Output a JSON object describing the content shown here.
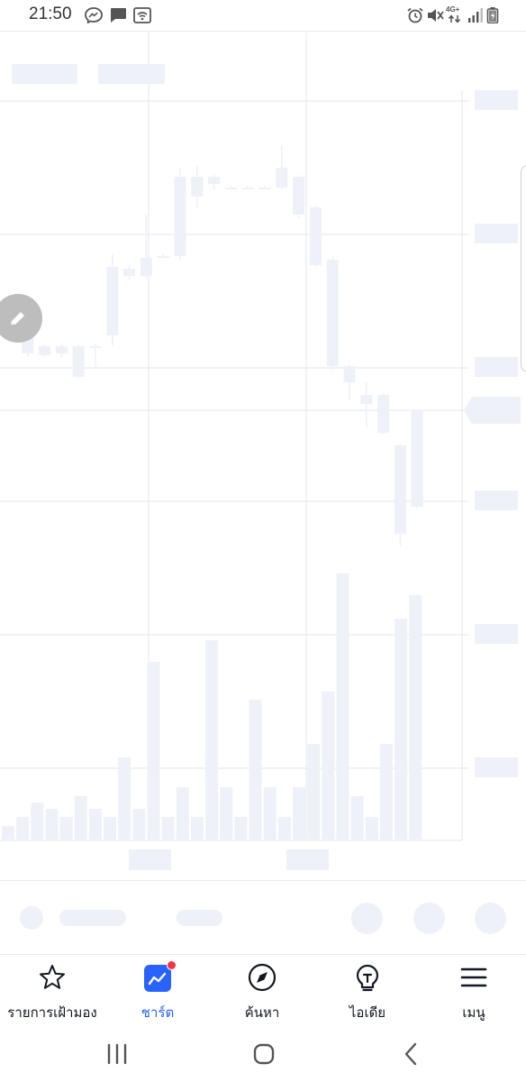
{
  "status_bar": {
    "time": "21:50",
    "left_icons": [
      "messenger-icon",
      "chat-icon",
      "wifi-call-icon"
    ],
    "right_icons": [
      "alarm-icon",
      "mute-icon",
      "network-4g-icon",
      "signal-icon",
      "battery-charging-icon"
    ],
    "network_label": "4G+"
  },
  "chart": {
    "type": "candlestick-with-volume",
    "loading_placeholder": true,
    "placeholder_color": "#eef1f8",
    "grid_color": "#e6ebf2",
    "candles": [
      {
        "o": 342,
        "c": 350,
        "h": 338,
        "l": 362
      },
      {
        "o": 374,
        "c": 392,
        "h": 372,
        "l": 395
      },
      {
        "o": 384,
        "c": 394,
        "h": 382,
        "l": 396
      },
      {
        "o": 384,
        "c": 392,
        "h": 382,
        "l": 396
      },
      {
        "o": 384,
        "c": 418,
        "h": 382,
        "l": 420
      },
      {
        "o": 384,
        "c": 386,
        "h": 382,
        "l": 408
      },
      {
        "o": 372,
        "c": 296,
        "h": 282,
        "l": 384
      },
      {
        "o": 306,
        "c": 298,
        "h": 294,
        "l": 310
      },
      {
        "o": 306,
        "c": 286,
        "h": 238,
        "l": 308
      },
      {
        "o": 286,
        "c": 284,
        "h": 282,
        "l": 286
      },
      {
        "o": 284,
        "c": 196,
        "h": 186,
        "l": 288
      },
      {
        "o": 218,
        "c": 196,
        "h": 184,
        "l": 230
      },
      {
        "o": 204,
        "c": 196,
        "h": 194,
        "l": 210
      },
      {
        "o": 208,
        "c": 208,
        "h": 206,
        "l": 210
      },
      {
        "o": 208,
        "c": 208,
        "h": 206,
        "l": 210
      },
      {
        "o": 208,
        "c": 208,
        "h": 206,
        "l": 210
      },
      {
        "o": 208,
        "c": 186,
        "h": 162,
        "l": 210
      },
      {
        "o": 196,
        "c": 238,
        "h": 194,
        "l": 242
      },
      {
        "o": 230,
        "c": 294,
        "h": 228,
        "l": 296
      },
      {
        "o": 288,
        "c": 406,
        "h": 284,
        "l": 410
      },
      {
        "o": 406,
        "c": 424,
        "h": 404,
        "l": 444
      },
      {
        "o": 438,
        "c": 448,
        "h": 424,
        "l": 474
      },
      {
        "o": 438,
        "c": 480,
        "h": 436,
        "l": 482
      },
      {
        "o": 494,
        "c": 592,
        "h": 492,
        "l": 606
      },
      {
        "o": 562,
        "c": 456,
        "h": 454,
        "l": 564
      }
    ],
    "volumes": [
      916,
      906,
      890,
      897,
      906,
      883,
      897,
      906,
      840,
      897,
      734,
      906,
      873,
      906,
      710,
      873,
      906,
      776,
      873,
      906,
      873,
      825,
      767,
      636,
      883,
      906,
      825,
      686,
      660
    ],
    "volume_base": 931,
    "price_label_placeholders": 8,
    "time_label_placeholders": 2,
    "legend_placeholders": 2
  },
  "toolbar": {
    "placeholder_pills": 2,
    "placeholder_circles": 4
  },
  "bottom_nav": {
    "items": [
      {
        "label": "รายการเฝ้ามอง",
        "icon": "star-icon",
        "active": false
      },
      {
        "label": "ชาร์ต",
        "icon": "chart-icon",
        "active": true,
        "badge": true
      },
      {
        "label": "ค้นหา",
        "icon": "compass-icon",
        "active": false
      },
      {
        "label": "ไอเดีย",
        "icon": "lightbulb-icon",
        "active": false
      },
      {
        "label": "เมนู",
        "icon": "hamburger-menu-icon",
        "active": false
      }
    ],
    "active_color": "#2962ff",
    "badge_color": "#f23645"
  },
  "system_nav": {
    "buttons": [
      "recent-apps-icon",
      "home-icon",
      "back-icon"
    ]
  }
}
